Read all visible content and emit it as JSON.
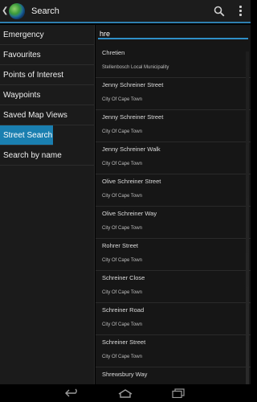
{
  "header": {
    "title": "Search",
    "back_icon": "back-chevron-icon",
    "app_icon": "globe-icon",
    "actions": [
      "search-icon",
      "overflow-menu-icon"
    ]
  },
  "sidebar": {
    "items": [
      {
        "label": "Emergency"
      },
      {
        "label": "Favourites"
      },
      {
        "label": "Points of Interest"
      },
      {
        "label": "Waypoints"
      },
      {
        "label": "Saved Map Views"
      },
      {
        "label": "Street Search"
      },
      {
        "label": "Search by name"
      }
    ],
    "active": "Street Search"
  },
  "search": {
    "value": "hre"
  },
  "results": [
    {
      "street": "Chretien",
      "city": "Stellenbosch Local Municipality"
    },
    {
      "street": "Jenny Schreiner Street",
      "city": "City Of Cape Town"
    },
    {
      "street": "Jenny Schreiner Street",
      "city": "City Of Cape Town"
    },
    {
      "street": "Jenny Schreiner Walk",
      "city": "City Of Cape Town"
    },
    {
      "street": "Olive Schreiner Street",
      "city": "City Of Cape Town"
    },
    {
      "street": "Olive Schreiner Way",
      "city": "City Of Cape Town"
    },
    {
      "street": "Rohrer Street",
      "city": "City Of Cape Town"
    },
    {
      "street": "Schreiner Close",
      "city": "City Of Cape Town"
    },
    {
      "street": "Schreiner Road",
      "city": "City Of Cape Town"
    },
    {
      "street": "Schreiner Street",
      "city": "City Of Cape Town"
    },
    {
      "street": "Shrewsbury Way",
      "city": ""
    }
  ],
  "navbar": [
    "back-nav-icon",
    "home-nav-icon",
    "recents-nav-icon"
  ],
  "colors": {
    "accent": "#1a7fb0",
    "underline": "#2f8fc8"
  }
}
